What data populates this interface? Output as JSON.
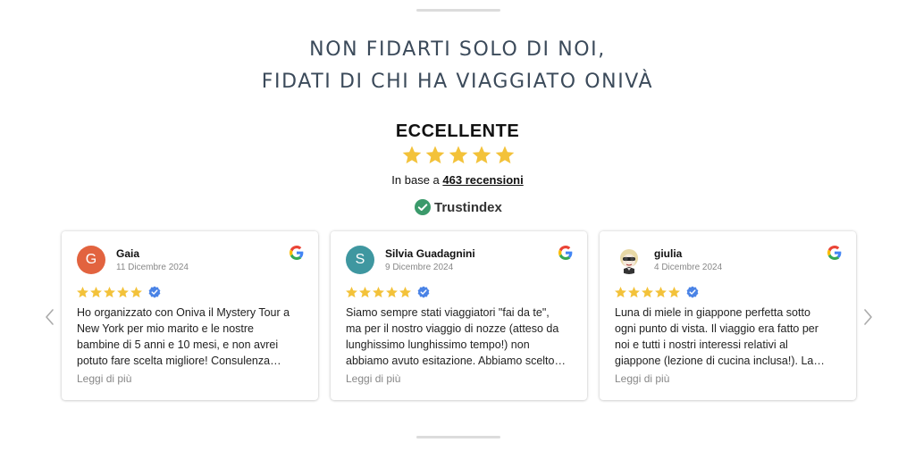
{
  "heading": {
    "line1": "NON FIDARTI SOLO DI NOI,",
    "line2": "FIDATI DI CHI HA VIAGGIATO ONIVÀ"
  },
  "summary": {
    "rating_word": "ECCELLENTE",
    "stars": 5,
    "based_prefix": "In base a ",
    "reviews_link": "463 recensioni",
    "brand": "Trustindex"
  },
  "colors": {
    "star": "#f3c23a",
    "verified": "#4a83e6",
    "trust_check": "#3b9a6b",
    "heading": "#3b4a5a"
  },
  "nav": {
    "prev_icon": "chevron-left-icon",
    "next_icon": "chevron-right-icon"
  },
  "reviews": [
    {
      "name": "Gaia",
      "initial": "G",
      "avatar_color": "#e2633f",
      "date": "11 Dicembre 2024",
      "stars": 5,
      "lines": [
        "Ho organizzato con Oniva il Mystery Tour a",
        "New York per mio marito e le nostre",
        "bambine di 5 anni e 10 mesi, e non avrei",
        "potuto fare scelta migliore! Consulenza…"
      ],
      "more": "Leggi di più"
    },
    {
      "name": "Silvia Guadagnini",
      "initial": "S",
      "avatar_color": "#3f97a0",
      "date": "9 Dicembre 2024",
      "stars": 5,
      "lines": [
        "Siamo sempre stati viaggiatori \"fai da te\",",
        "ma per il nostro viaggio di nozze (atteso da",
        "lunghissimo lunghissimo tempo!) non",
        "abbiamo avuto esitazione. Abbiamo scelto…"
      ],
      "more": "Leggi di più"
    },
    {
      "name": "giulia",
      "initial": "",
      "avatar_color": "#ffffff",
      "date": "4 Dicembre 2024",
      "stars": 5,
      "lines": [
        "Luna di miele in giappone perfetta sotto",
        "ogni punto di vista. Il viaggio era fatto per",
        "noi e tutti i nostri interessi relativi al",
        "giappone (lezione di cucina inclusa!). La…"
      ],
      "more": "Leggi di più"
    }
  ]
}
